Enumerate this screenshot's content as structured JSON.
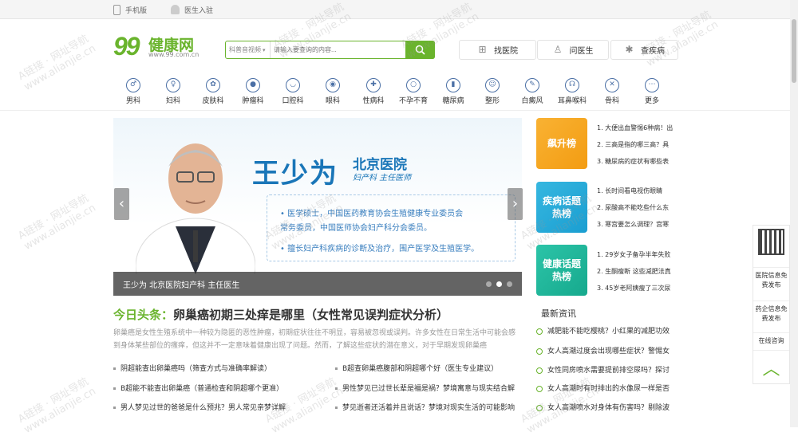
{
  "topbar": {
    "mobile_label": "手机版",
    "doctor_join_label": "医生入驻"
  },
  "logo": {
    "number": "99",
    "name": "健康网",
    "url": "www.99.com.cn"
  },
  "search": {
    "category": "科普音视频",
    "placeholder": "请输入要查询的内容..."
  },
  "quick_buttons": [
    {
      "label": "找医院",
      "icon": "hospital-icon"
    },
    {
      "label": "问医生",
      "icon": "doctor-icon"
    },
    {
      "label": "查疾病",
      "icon": "disease-icon"
    }
  ],
  "categories": [
    {
      "label": "男科",
      "icon": "male-icon"
    },
    {
      "label": "妇科",
      "icon": "female-icon"
    },
    {
      "label": "皮肤科",
      "icon": "skin-icon"
    },
    {
      "label": "肿瘤科",
      "icon": "tumor-icon"
    },
    {
      "label": "口腔科",
      "icon": "tooth-icon"
    },
    {
      "label": "眼科",
      "icon": "eye-icon"
    },
    {
      "label": "性病科",
      "icon": "std-icon"
    },
    {
      "label": "不孕不育",
      "icon": "fertility-icon"
    },
    {
      "label": "糖尿病",
      "icon": "diabetes-icon"
    },
    {
      "label": "整形",
      "icon": "plastic-icon"
    },
    {
      "label": "白癜风",
      "icon": "vitiligo-icon"
    },
    {
      "label": "耳鼻喉科",
      "icon": "ent-icon"
    },
    {
      "label": "骨科",
      "icon": "bone-icon"
    },
    {
      "label": "更多",
      "icon": "more-icon"
    }
  ],
  "banner": {
    "name": "王少为",
    "hospital": "北京医院",
    "title": "妇产科  主任医师",
    "bio": [
      "• 医学硕士，中国医药教育协会生殖健康专业委员会",
      "   常务委员，中国医师协会妇产科分会委员。",
      "• 擅长妇产科疾病的诊断及治疗，围产医学及生殖医学。"
    ],
    "caption": "王少为 北京医院妇产科 主任医生"
  },
  "headline": {
    "tag": "今日头条：",
    "title": "卵巢癌初期三处痒是哪里（女性常见误判症状分析）"
  },
  "summary": "卵巢癌是女性生殖系统中一种较为隐匿的恶性肿瘤，初期症状往往不明显，容易被忽视或误判。许多女性在日常生活中可能会感到身体某些部位的瘙痒，但这并不一定意味着健康出现了问题。然而，了解这些症状的潜在意义，对于早期发现卵巢癌",
  "articles": [
    "阴超能查出卵巢癌吗（筛查方式与准确率解读）",
    "B超查卵巢癌腹部和阴超哪个好（医生专业建议）",
    "B超能不能查出卵巢癌（普通检查和阴超哪个更准）",
    "男性梦见已过世长辈是福是祸？梦境寓意与现实结合解",
    "男人梦见过世的爸爸是什么预兆？男人常见亲梦详解",
    "梦见逝者还活着并且说话？梦境对现实生活的可能影响"
  ],
  "rank_boxes": [
    {
      "title": "飙升榜",
      "color_top": "#f9b233",
      "color_bottom": "#f39c12",
      "items": [
        "1.  大便出血警惕6种病！出",
        "2.  三高是指的哪三高？具",
        "3.  糖尿病的症状有哪些表"
      ]
    },
    {
      "title": "疾病话题热榜",
      "color_top": "#36b7e0",
      "color_bottom": "#1a9ed1",
      "items": [
        "1.  长时间看电视伤眼睛",
        "2.  尿酸高不能吃些什么东",
        "3.  寒宫要怎么调理？宫寒"
      ]
    },
    {
      "title": "健康话题热榜",
      "color_top": "#2cc4a8",
      "color_bottom": "#16a98d",
      "items": [
        "1.  29岁女子备孕半年失败",
        "2.  生酮瘦断 这些减肥法真",
        "3.  45岁老阿姨瘦了三次尿"
      ]
    }
  ],
  "news": {
    "heading": "最新资讯",
    "items": [
      "减肥能不能吃樱桃？小红果的减肥功效",
      "女人高潮过度会出现哪些症状？警惕女",
      "女性同房喷水需要提前排空尿吗？探讨",
      "女人高潮时有时排出的水像尿一样是否",
      "女人高潮喷水对身体有伤害吗？剔除波"
    ]
  },
  "sidebar": {
    "items": [
      "医院信息免费发布",
      "药企信息免费发布",
      "在线咨询"
    ]
  },
  "watermark": {
    "line1": "A链接 · 网址导航",
    "line2": "www.alianjie.cn"
  },
  "colors": {
    "brand_green": "#6ab42d",
    "banner_blue": "#1a76b8"
  }
}
